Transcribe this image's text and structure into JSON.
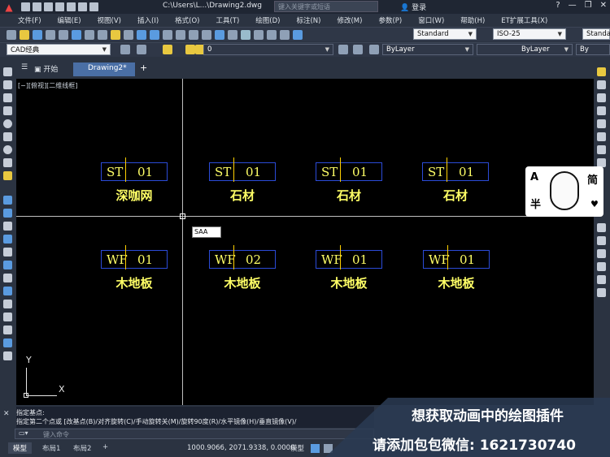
{
  "title": {
    "file": "C:\\Users\\L...\\Drawing2.dwg",
    "search_placeholder": "键入关键字或短语",
    "user": "登录"
  },
  "menu": [
    "文件(F)",
    "编辑(E)",
    "视图(V)",
    "插入(I)",
    "格式(O)",
    "工具(T)",
    "绘图(D)",
    "标注(N)",
    "修改(M)",
    "参数(P)",
    "窗口(W)",
    "帮助(H)",
    "ET扩展工具(X)"
  ],
  "toolbar1": {
    "text_style": "Standard",
    "dim_style": "ISO-25",
    "table_style": "Standa"
  },
  "toolbar2": {
    "workspace": "CAD经典",
    "layer": "0",
    "color": "ByLayer",
    "linetype": "ByLayer",
    "lineweight": "By"
  },
  "tabs": {
    "start": "开始",
    "drawing": "Drawing2*",
    "plus": "+"
  },
  "canvas": {
    "view_label": "[−][俯视][二维线框]",
    "command_popup": "SAA",
    "ucs_x": "X",
    "ucs_y": "Y"
  },
  "tags": [
    {
      "code": "ST",
      "num": "01",
      "label": "深咖网"
    },
    {
      "code": "ST",
      "num": "01",
      "label": "石材"
    },
    {
      "code": "ST",
      "num": "01",
      "label": "石材"
    },
    {
      "code": "ST",
      "num": "01",
      "label": "石材"
    },
    {
      "code": "WF",
      "num": "01",
      "label": "木地板"
    },
    {
      "code": "WF",
      "num": "02",
      "label": "木地板"
    },
    {
      "code": "WF",
      "num": "01",
      "label": "木地板"
    },
    {
      "code": "WF",
      "num": "01",
      "label": "木地板"
    }
  ],
  "sticker": {
    "a": "A",
    "jian": "简",
    "ban": "半"
  },
  "command": {
    "line1": "指定基点:",
    "line2": "指定第二个点或 [改基点(B)/对齐旋转(C)/手动旋转关(M)/旋转90度(R)/水平镜像(H)/垂直镜像(V)/",
    "input_placeholder": "键入命令"
  },
  "layout_tabs": [
    "模型",
    "布局1",
    "布局2",
    "+"
  ],
  "status": {
    "coords": "1000.9066, 2071.9338, 0.0000",
    "model": "模型"
  },
  "ad": {
    "line1": "想获取动画中的绘图插件",
    "line2": "请添加包包微信: 1621730740"
  }
}
